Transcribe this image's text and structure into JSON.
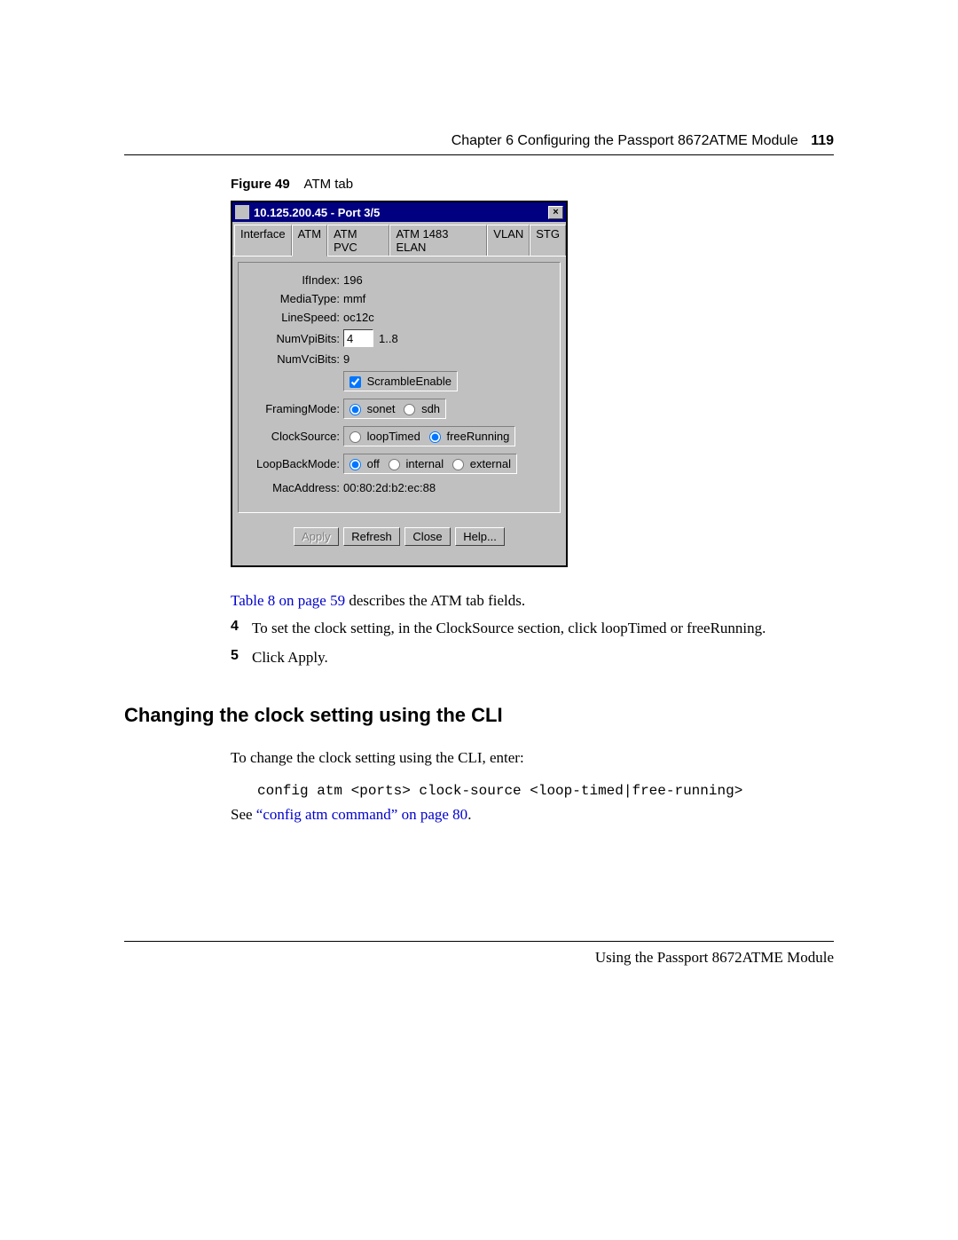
{
  "header": {
    "chapter": "Chapter 6  Configuring the Passport 8672ATME Module",
    "page_number": "119"
  },
  "figure": {
    "label": "Figure 49",
    "caption": "ATM tab"
  },
  "dialog": {
    "title": "10.125.200.45 - Port 3/5",
    "close": "×",
    "tabs": [
      "Interface",
      "ATM",
      "ATM PVC",
      "ATM 1483 ELAN",
      "VLAN",
      "STG"
    ],
    "active_tab": 1,
    "fields": {
      "ifindex_label": "IfIndex:",
      "ifindex_value": "196",
      "mediatype_label": "MediaType:",
      "mediatype_value": "mmf",
      "linespeed_label": "LineSpeed:",
      "linespeed_value": "oc12c",
      "numvpibits_label": "NumVpiBits:",
      "numvpibits_value": "4",
      "numvpibits_hint": "1..8",
      "numvcibits_label": "NumVciBits:",
      "numvcibits_value": "9",
      "scramble_label": "ScrambleEnable",
      "scramble_checked": true,
      "framingmode_label": "FramingMode:",
      "framingmode_options": [
        "sonet",
        "sdh"
      ],
      "framingmode_selected": 0,
      "clocksource_label": "ClockSource:",
      "clocksource_options": [
        "loopTimed",
        "freeRunning"
      ],
      "clocksource_selected": 1,
      "loopback_label": "LoopBackMode:",
      "loopback_options": [
        "off",
        "internal",
        "external"
      ],
      "loopback_selected": 0,
      "mac_label": "MacAddress:",
      "mac_value": "00:80:2d:b2:ec:88"
    },
    "buttons": {
      "apply": "Apply",
      "refresh": "Refresh",
      "close": "Close",
      "help": "Help..."
    }
  },
  "body": {
    "ref_link": "Table 8 on page 59",
    "ref_tail": " describes the ATM tab fields.",
    "steps": [
      {
        "n": "4",
        "text": "To set the clock setting, in the ClockSource section, click loopTimed or freeRunning."
      },
      {
        "n": "5",
        "text": "Click Apply."
      }
    ],
    "section_heading": "Changing the clock setting using the CLI",
    "intro": "To change the clock setting using the CLI, enter:",
    "command": "config atm <ports> clock-source <loop-timed|free-running>",
    "see_pre": "See ",
    "see_link": "“config atm command” on page 80",
    "see_post": "."
  },
  "footer": {
    "text": "Using the Passport 8672ATME Module"
  }
}
